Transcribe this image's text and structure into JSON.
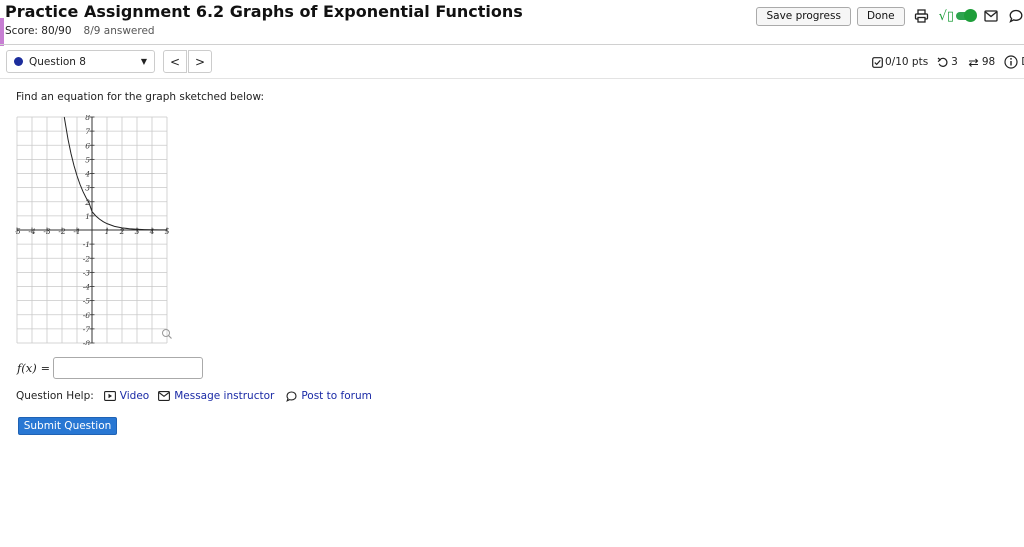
{
  "header": {
    "title": "Practice Assignment 6.2 Graphs of Exponential Functions",
    "score": "Score: 80/90",
    "answered": "8/9 answered",
    "save_label": "Save progress",
    "done_label": "Done"
  },
  "question_bar": {
    "selected_question": "Question 8",
    "prev_symbol": "<",
    "next_symbol": ">",
    "points": "0/10 pts",
    "attempts": "3",
    "retries": "98",
    "details_label": "De"
  },
  "question": {
    "prompt": "Find an equation for the graph sketched below:",
    "answer_label": "f(x)",
    "equals": "=",
    "answer_value": ""
  },
  "help": {
    "label": "Question Help:",
    "video": "Video",
    "message": "Message instructor",
    "forum": "Post to forum"
  },
  "submit_label": "Submit Question",
  "colors": {
    "accent": "#c77fd3",
    "submit": "#2877d3",
    "link": "#1a2aa6",
    "toggle": "#2ea44f",
    "question_dot": "#1c2d9c"
  },
  "chart_data": {
    "type": "line",
    "title": "",
    "xlabel": "",
    "ylabel": "",
    "xlim": [
      -5,
      5
    ],
    "ylim": [
      -8,
      8
    ],
    "grid": true,
    "x_ticks": [
      "-5",
      "-4",
      "-3",
      "-2",
      "-1",
      "1",
      "2",
      "3",
      "4",
      "5"
    ],
    "y_ticks": [
      "8",
      "7",
      "6",
      "5",
      "4",
      "3",
      "2",
      "1",
      "-1",
      "-2",
      "-3",
      "-4",
      "-5",
      "-6",
      "-7",
      "-8"
    ],
    "x_tick_values": [
      -5,
      -4,
      -3,
      -2,
      -1,
      1,
      2,
      3,
      4,
      5
    ],
    "y_tick_values": [
      8,
      7,
      6,
      5,
      4,
      3,
      2,
      1,
      -1,
      -2,
      -3,
      -4,
      -5,
      -6,
      -7,
      -8
    ],
    "series": [
      {
        "x": [
          -1.85,
          -1.6,
          -1.4,
          -1.2,
          -1.0,
          -0.8,
          -0.6,
          -0.4,
          -0.2,
          0,
          0.25,
          0.5,
          0.75,
          1.0,
          1.5,
          2.0,
          2.5,
          3.0,
          3.5,
          4.0,
          4.5,
          5.0
        ],
        "y": [
          8.0,
          6.43,
          5.41,
          4.56,
          3.84,
          3.23,
          2.72,
          2.29,
          1.93,
          1.3,
          1.0,
          0.77,
          0.59,
          0.45,
          0.26,
          0.15,
          0.09,
          0.05,
          0.03,
          0.02,
          0.01,
          0.01
        ]
      }
    ]
  }
}
